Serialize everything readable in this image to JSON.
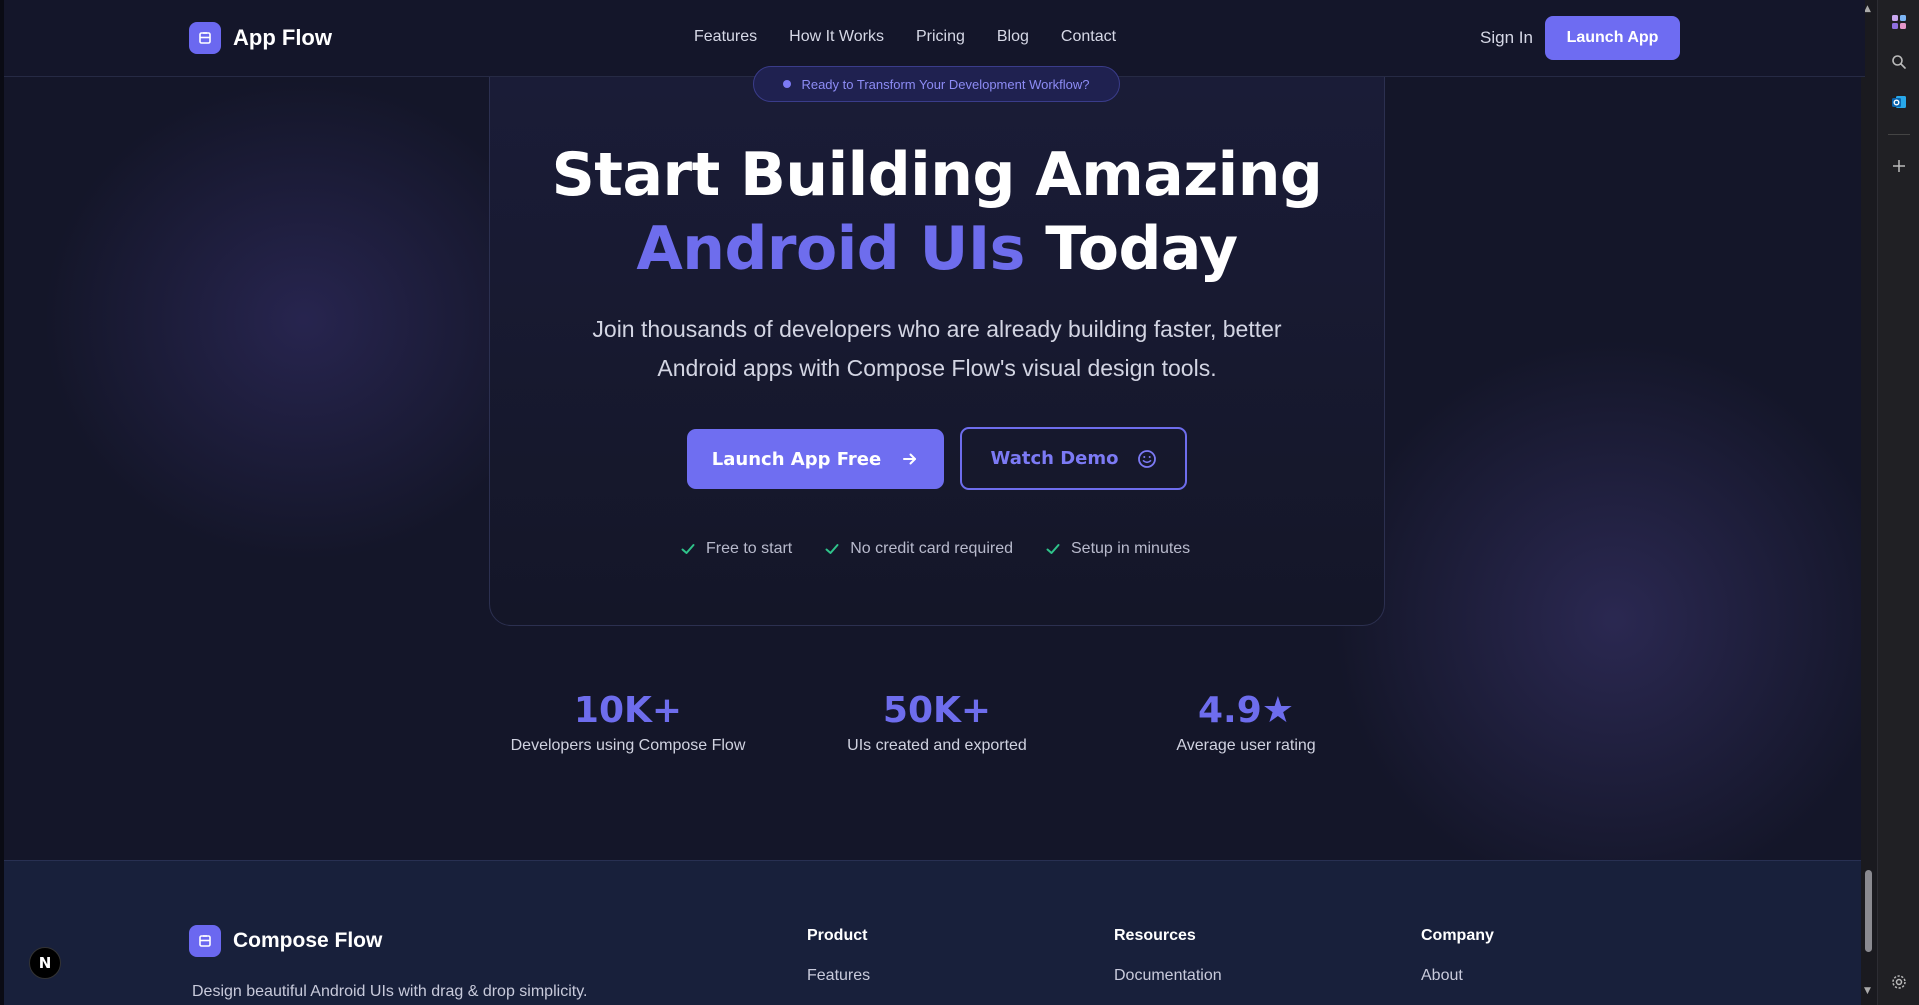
{
  "header": {
    "brand": "App Flow",
    "nav": [
      "Features",
      "How It Works",
      "Pricing",
      "Blog",
      "Contact"
    ],
    "sign_in": "Sign In",
    "launch_app": "Launch App"
  },
  "hero": {
    "badge": "Ready to Transform Your Development Workflow?",
    "title_line1": "Start Building Amazing",
    "title_accent": "Android UIs",
    "title_rest": "Today",
    "subtitle_line1": "Join thousands of developers who are already building faster, better",
    "subtitle_line2": "Android apps with Compose Flow's visual design tools.",
    "primary_button": "Launch App Free",
    "secondary_button": "Watch Demo",
    "checks": [
      "Free to start",
      "No credit card required",
      "Setup in minutes"
    ]
  },
  "stats": [
    {
      "value": "10K+",
      "label": "Developers using Compose Flow"
    },
    {
      "value": "50K+",
      "label": "UIs created and exported"
    },
    {
      "value": "4.9★",
      "label": "Average user rating"
    }
  ],
  "footer": {
    "brand": "Compose Flow",
    "description": "Design beautiful Android UIs with drag & drop simplicity.",
    "columns": [
      {
        "heading": "Product",
        "first_item": "Features"
      },
      {
        "heading": "Resources",
        "first_item": "Documentation"
      },
      {
        "heading": "Company",
        "first_item": "About"
      }
    ]
  },
  "dev_badge": "N",
  "colors": {
    "accent": "#6e6ded",
    "background": "#141629",
    "footer_bg": "#18203b",
    "check_green": "#2fc38a"
  }
}
